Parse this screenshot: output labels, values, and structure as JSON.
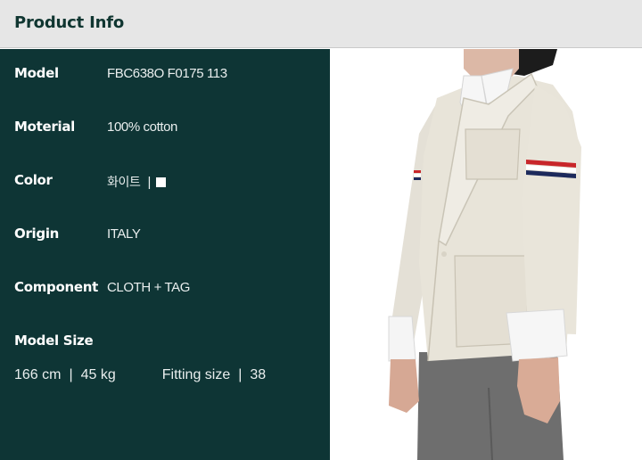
{
  "header": {
    "title": "Product Info"
  },
  "info": {
    "model": {
      "label": "Model",
      "value": "FBC638O F0175 113"
    },
    "material": {
      "label": "Moterial",
      "value": "100% cotton"
    },
    "color": {
      "label": "Color",
      "value": "화이트",
      "separator": "|",
      "swatch_color": "#ffffff"
    },
    "origin": {
      "label": "Origin",
      "value": "ITALY"
    },
    "component": {
      "label": "Component",
      "value": "CLOTH + TAG"
    }
  },
  "model_size": {
    "label": "Model Size",
    "height": "166 cm",
    "separator": "|",
    "weight": "45 kg",
    "fitting_label": "Fitting size",
    "fitting_value": "38"
  },
  "colors": {
    "header_bg": "#e6e6e6",
    "header_text": "#103631",
    "panel_bg": "#0e3535"
  },
  "photo": {
    "subject": "model-wearing-blazer"
  }
}
